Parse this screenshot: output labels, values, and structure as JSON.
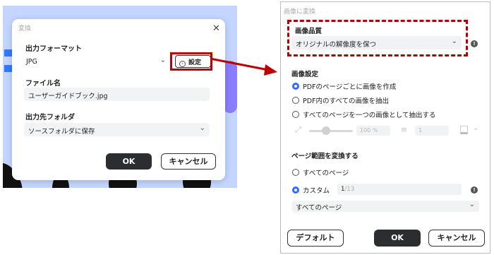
{
  "small_dialog": {
    "title": "変換",
    "close": "✕",
    "output_format_label": "出力フォーマット",
    "output_format_value": "JPG",
    "settings_button": "設定",
    "file_name_label": "ファイル名",
    "file_name_value": "ユーザーガイドブック.jpg",
    "output_folder_label": "出力先フォルダ",
    "output_folder_value": "ソースフォルダに保存",
    "ok_button": "OK",
    "cancel_button": "キャンセル"
  },
  "big_dialog": {
    "title": "画像に変換",
    "quality_label": "画像品質",
    "quality_value": "オリジナルの解像度を保つ",
    "image_settings_label": "画像設定",
    "image_options": [
      {
        "label": "PDFのページごとに画像を作成",
        "selected": true
      },
      {
        "label": "PDF内のすべての画像を抽出",
        "selected": false
      },
      {
        "label": "すべてのページを一つの画像として抽出する",
        "selected": false
      }
    ],
    "zoom_value": "100 %",
    "spacing_value": "1",
    "page_range_label": "ページ範囲を変換する",
    "range_options": [
      {
        "label": "すべてのページ",
        "selected": false
      },
      {
        "label": "カスタム",
        "selected": true
      }
    ],
    "custom_page_current": "1",
    "custom_page_total": "/13",
    "page_subset_value": "すべてのページ",
    "default_button": "デフォルト",
    "ok_button": "OK",
    "cancel_button": "キャンセル"
  },
  "colors": {
    "accent_red": "#c00000",
    "radio_blue": "#2f6bff",
    "dark_button": "#2b2d31",
    "backdrop": "#c4d6ff"
  },
  "icons": [
    "close-icon",
    "gear-icon",
    "chevron-down-icon",
    "info-icon",
    "resize-icon",
    "menu-lines-icon",
    "color-swatch-icon",
    "red-arrow"
  ]
}
